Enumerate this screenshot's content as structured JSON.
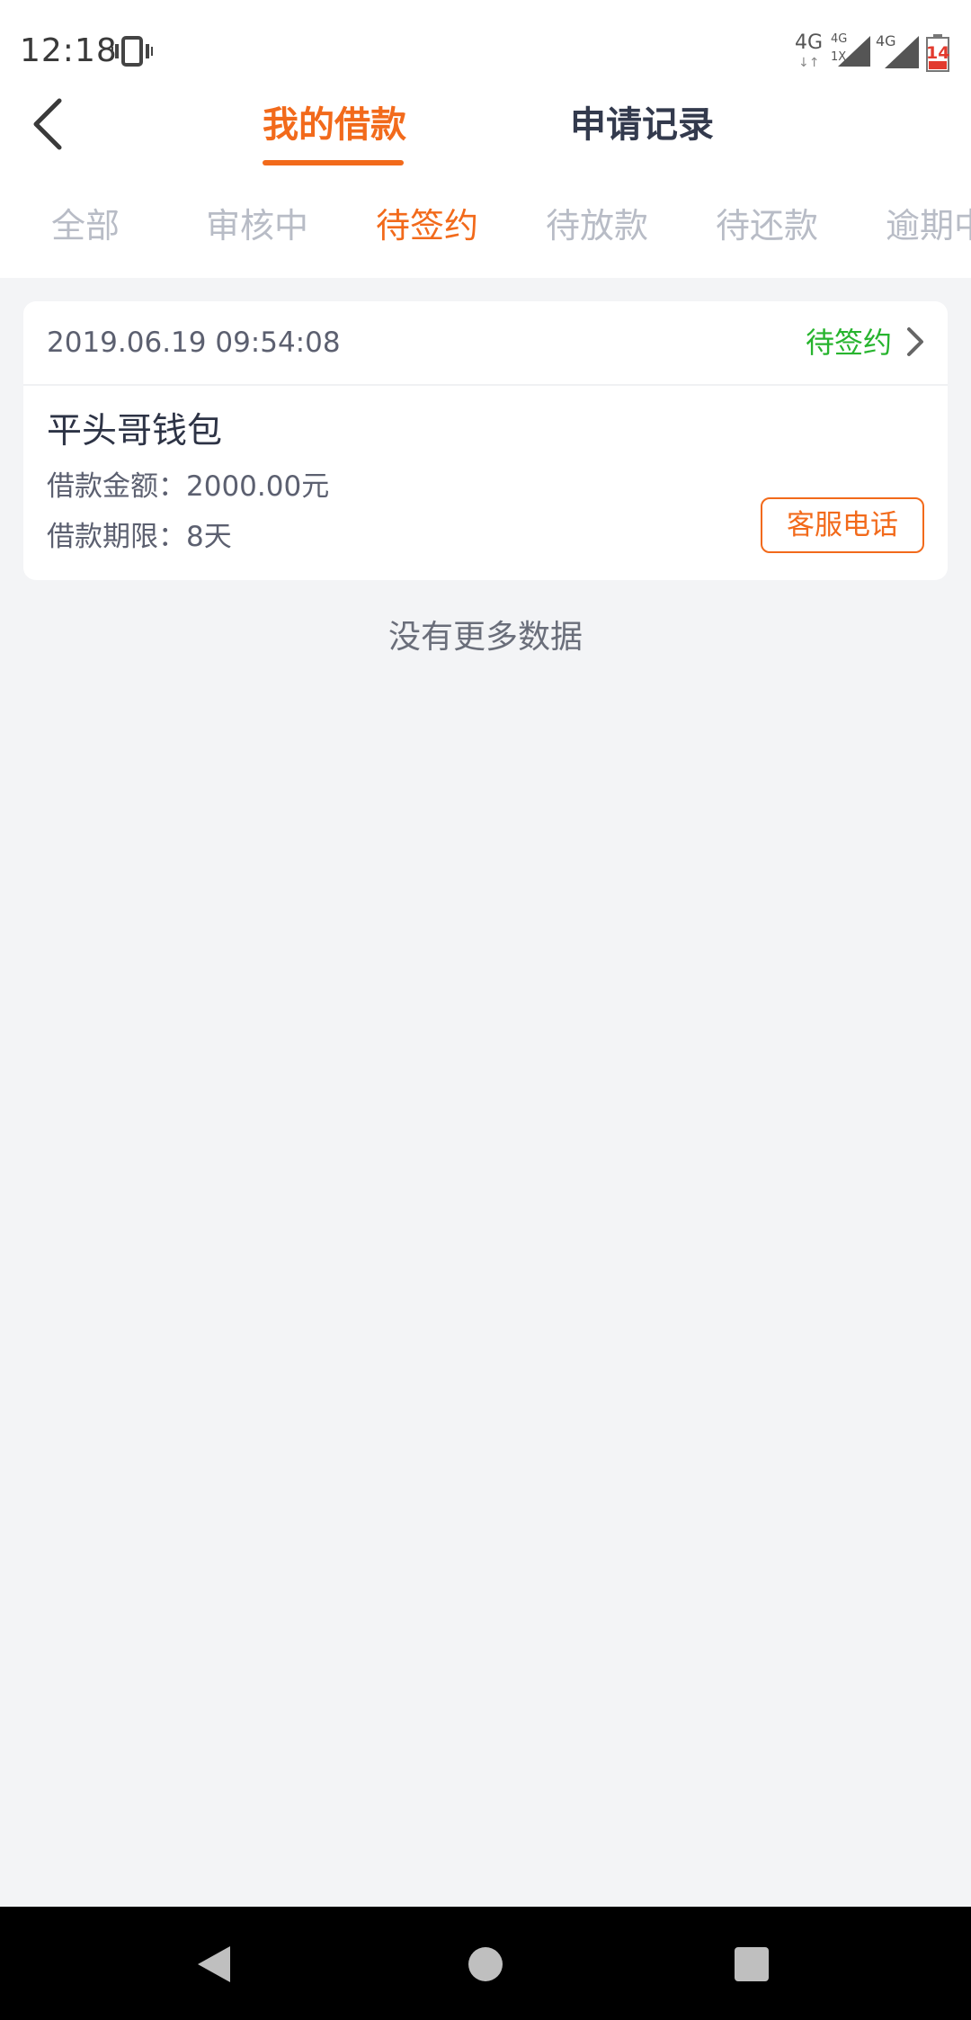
{
  "status_bar": {
    "time": "12:18",
    "net1": "4G",
    "net2_top": "4G",
    "net2_bottom": "1X",
    "net3": "4G",
    "battery": "14"
  },
  "header": {
    "tabs": [
      {
        "label": "我的借款",
        "active": true
      },
      {
        "label": "申请记录",
        "active": false
      }
    ]
  },
  "filters": [
    {
      "label": "全部"
    },
    {
      "label": "审核中"
    },
    {
      "label": "待签约"
    },
    {
      "label": "待放款"
    },
    {
      "label": "待还款"
    },
    {
      "label": "逾期中"
    }
  ],
  "active_filter": "待签约",
  "loan": {
    "date": "2019.06.19 09:54:08",
    "status": "待签约",
    "product": "平头哥钱包",
    "amount_line": "借款金额：2000.00元",
    "term_line": "借款期限：8天",
    "service_button": "客服电话"
  },
  "footer_text": "没有更多数据",
  "colors": {
    "accent": "#f26a1b",
    "status_green": "#27b42e",
    "background": "#f3f4f6"
  }
}
